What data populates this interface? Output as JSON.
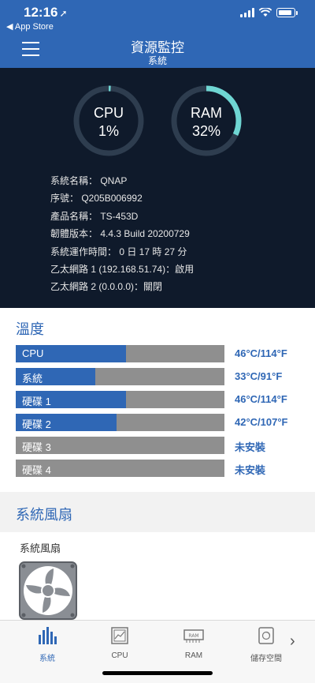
{
  "status_bar": {
    "time": "12:16",
    "back_label": "◀ App Store"
  },
  "header": {
    "title": "資源監控",
    "subtitle": "系統"
  },
  "gauges": [
    {
      "label": "CPU",
      "value": "1%",
      "percent": 1,
      "color": "#6fd6d3"
    },
    {
      "label": "RAM",
      "value": "32%",
      "percent": 32,
      "color": "#6fd6d3"
    }
  ],
  "system_info": {
    "name": "系統名稱： QNAP",
    "serial": "序號： Q205B006992",
    "model": "產品名稱： TS-453D",
    "firmware": "韌體版本： 4.4.3 Build 20200729",
    "uptime": "系統運作時間： 0 日 17 時 27 分",
    "eth1": "乙太網路 1 (192.168.51.74)：啟用",
    "eth2": "乙太網路 2 (0.0.0.0)：關閉"
  },
  "temperature": {
    "title": "溫度",
    "rows": [
      {
        "label": "CPU",
        "value": "46°C/114°F",
        "fill": 0.46
      },
      {
        "label": "系統",
        "value": "33°C/91°F",
        "fill": 0.33
      },
      {
        "label": "硬碟 1",
        "value": "46°C/114°F",
        "fill": 0.46
      },
      {
        "label": "硬碟 2",
        "value": "42°C/107°F",
        "fill": 0.42
      },
      {
        "label": "硬碟 3",
        "value": "未安裝",
        "fill": 0
      },
      {
        "label": "硬碟 4",
        "value": "未安裝",
        "fill": 0
      }
    ]
  },
  "fan": {
    "section_title": "系統風扇",
    "name": "系統風扇"
  },
  "tabs": [
    {
      "label": "系統",
      "icon": "bar-chart-icon",
      "active": true
    },
    {
      "label": "CPU",
      "icon": "cpu-icon",
      "active": false
    },
    {
      "label": "RAM",
      "icon": "ram-icon",
      "active": false
    },
    {
      "label": "儲存空間",
      "icon": "storage-icon",
      "active": false
    }
  ],
  "colors": {
    "brand": "#2f67b5",
    "dark_panel": "#0f1a2b",
    "gauge_arc": "#6fd6d3",
    "bar_empty": "#8f8f8f"
  }
}
